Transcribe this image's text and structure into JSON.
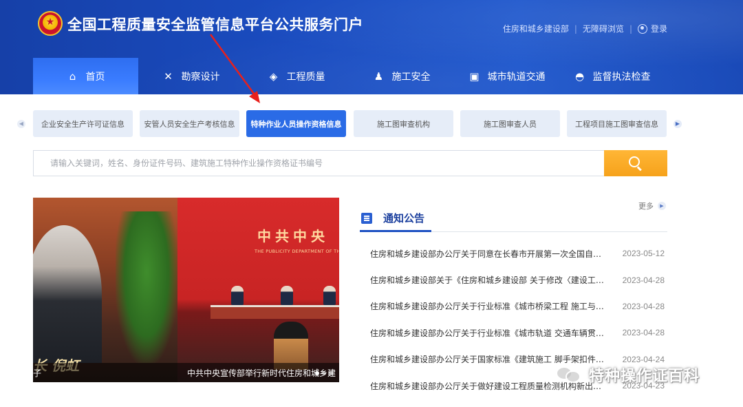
{
  "header": {
    "site_title": "全国工程质量安全监管信息平台公共服务门户",
    "top_links": [
      "住房和城乡建设部",
      "无障碍浏览"
    ],
    "login_label": "登录"
  },
  "nav": [
    {
      "label": "首页",
      "icon": "home-icon",
      "active": true
    },
    {
      "label": "勘察设计",
      "icon": "tools-icon",
      "active": false
    },
    {
      "label": "工程质量",
      "icon": "shield-icon",
      "active": false
    },
    {
      "label": "施工安全",
      "icon": "worker-icon",
      "active": false
    },
    {
      "label": "城市轨道交通",
      "icon": "train-icon",
      "active": false
    },
    {
      "label": "监督执法检查",
      "icon": "inspector-icon",
      "active": false
    }
  ],
  "tabs": [
    {
      "label": "企业安全生产许可证信息",
      "active": false
    },
    {
      "label": "安管人员安全生产考核信息",
      "active": false
    },
    {
      "label": "特种作业人员操作资格信息",
      "active": true
    },
    {
      "label": "施工图审查机构",
      "active": false
    },
    {
      "label": "施工图审查人员",
      "active": false
    },
    {
      "label": "工程项目施工图审查信息",
      "active": false
    }
  ],
  "search": {
    "placeholder": "请输入关键词，姓名、身份证件号码、建筑施工特种作业操作资格证书编号"
  },
  "slideshow": {
    "left_overlay": "长 倪虹",
    "left_caption": "子",
    "banner_title": "中共中央",
    "banner_sub": "THE PUBLICITY DEPARTMENT OF THE C",
    "caption": "中共中央宣传部举行新时代住房和城乡建",
    "dots": 3,
    "active_dot": 0
  },
  "notice": {
    "title": "通知公告",
    "more_label": "更多",
    "items": [
      {
        "title": "住房和城乡建设部办公厅关于同意在长春市开展第一次全国自…",
        "date": "2023-05-12"
      },
      {
        "title": "住房和城乡建设部关于《住房和城乡建设部 关于修改〈建设工…",
        "date": "2023-04-28"
      },
      {
        "title": "住房和城乡建设部办公厅关于行业标准《城市桥梁工程 施工与…",
        "date": "2023-04-28"
      },
      {
        "title": "住房和城乡建设部办公厅关于行业标准《城市轨道 交通车辆贯…",
        "date": "2023-04-28"
      },
      {
        "title": "住房和城乡建设部办公厅关于国家标准《建筑施工 脚手架扣件…",
        "date": "2023-04-24"
      },
      {
        "title": "住房和城乡建设部办公厅关于做好建设工程质量检测机构新出…",
        "date": "2023-04-23"
      }
    ]
  },
  "watermark": {
    "text": "特种操作证百科",
    "icon": "wechat-icon"
  },
  "colors": {
    "header_blue": "#1a4cc0",
    "active_tab": "#2a6be6",
    "search_orange": "#f6a21b",
    "annotation_red": "#e8201c"
  }
}
